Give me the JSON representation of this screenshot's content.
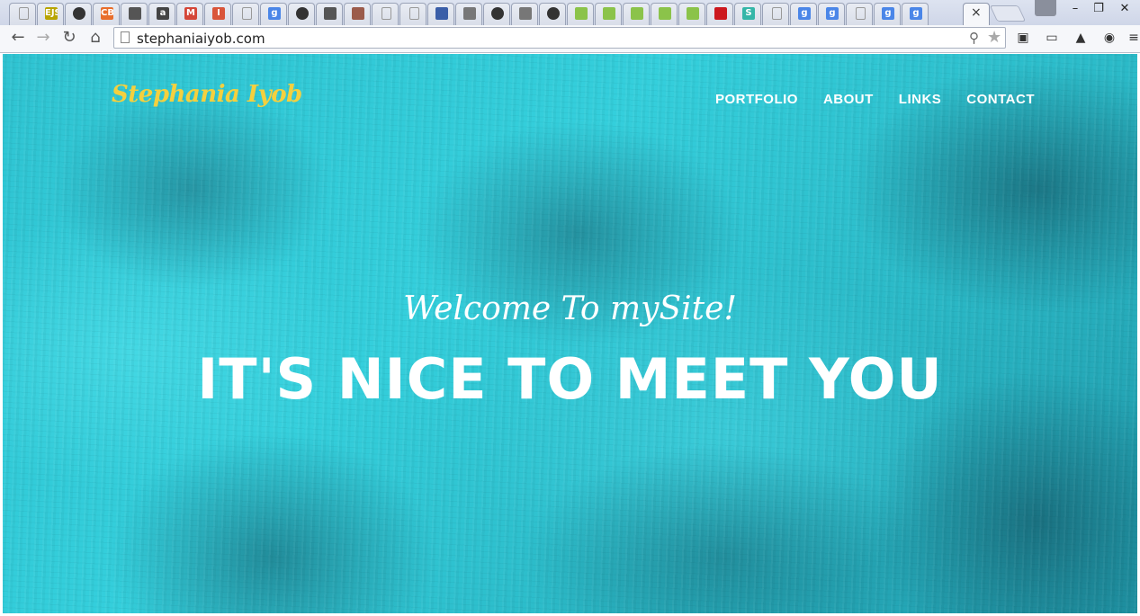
{
  "browser": {
    "url": "stephaniaiyob.com",
    "tabs": [
      {
        "icon": "blank-page-icon",
        "label": ""
      },
      {
        "icon": "ejs-icon",
        "label": "EJS"
      },
      {
        "icon": "github-icon",
        "label": ""
      },
      {
        "icon": "cb-icon",
        "label": "CB"
      },
      {
        "icon": "glasses-icon",
        "label": ""
      },
      {
        "icon": "a-icon",
        "label": "a"
      },
      {
        "icon": "gmail-icon",
        "label": "M"
      },
      {
        "icon": "i-icon",
        "label": "I"
      },
      {
        "icon": "blank-page-icon",
        "label": ""
      },
      {
        "icon": "google-icon",
        "label": "g"
      },
      {
        "icon": "github-icon",
        "label": ""
      },
      {
        "icon": "m-icon",
        "label": ""
      },
      {
        "icon": "photo-icon",
        "label": ""
      },
      {
        "icon": "blank-page-icon",
        "label": ""
      },
      {
        "icon": "blank-page-icon",
        "label": ""
      },
      {
        "icon": "vmware-icon",
        "label": ""
      },
      {
        "icon": "hand-icon",
        "label": ""
      },
      {
        "icon": "github-icon",
        "label": ""
      },
      {
        "icon": "ls-icon",
        "label": ""
      },
      {
        "icon": "github-icon",
        "label": ""
      },
      {
        "icon": "codeschool-icon",
        "label": ""
      },
      {
        "icon": "codeschool-icon",
        "label": ""
      },
      {
        "icon": "codeschool-icon",
        "label": ""
      },
      {
        "icon": "codeschool-icon",
        "label": ""
      },
      {
        "icon": "codeschool-icon",
        "label": ""
      },
      {
        "icon": "youtube-icon",
        "label": ""
      },
      {
        "icon": "s-icon",
        "label": "S"
      },
      {
        "icon": "blank-page-icon",
        "label": ""
      },
      {
        "icon": "google-icon",
        "label": "g"
      },
      {
        "icon": "google-icon",
        "label": "g"
      },
      {
        "icon": "blank-page-icon",
        "label": ""
      },
      {
        "icon": "google-icon",
        "label": "g"
      },
      {
        "icon": "google-icon",
        "label": "g"
      }
    ],
    "active_tab_close": "×",
    "window_controls": {
      "minimize": "–",
      "restore": "❐",
      "close": "✕"
    }
  },
  "site": {
    "brand": "Stephania Iyob",
    "nav": [
      "PORTFOLIO",
      "ABOUT",
      "LINKS",
      "CONTACT"
    ],
    "hero_subtitle": "Welcome To mySite!",
    "hero_title": "IT'S NICE TO MEET YOU"
  },
  "colors": {
    "brand": "#f4d03f",
    "hero_background": "#2fc4d2",
    "nav_text": "#ffffff"
  }
}
